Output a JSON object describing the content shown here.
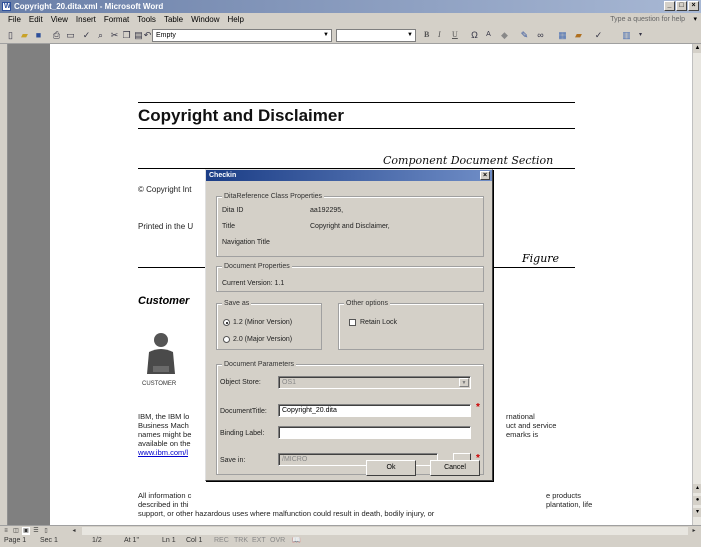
{
  "window": {
    "title": "Copyright_20.dita.xml - Microsoft Word",
    "controls": [
      "_",
      "□",
      "×"
    ]
  },
  "menubar": {
    "items": [
      "File",
      "Edit",
      "View",
      "Insert",
      "Format",
      "Tools",
      "Table",
      "Window",
      "Help"
    ],
    "help_placeholder": "Type a question for help"
  },
  "toolbar": {
    "style_value": "Empty",
    "formatting": [
      "B",
      "I",
      "U"
    ]
  },
  "document": {
    "title": "Copyright and Disclaimer",
    "component_section": "Component Document Section",
    "copyright_line": "© Copyright Int",
    "printed_line": "Printed in the U",
    "figure_label": "Figure",
    "customer_heading": "Customer",
    "customer_image_label": "CUSTOMER",
    "ibm_para_lines": [
      "IBM, the IBM lo",
      "Business Mach",
      "names might be",
      "available on the"
    ],
    "ibm_link": "www.ibm.com/l",
    "right_para_lines": [
      "rnational",
      "uct and service",
      "emarks is"
    ],
    "all_info_lines": [
      "All information c",
      "described in thi",
      "support, or other hazardous uses where malfunction could result in death, bodily injury, or"
    ],
    "all_info_right_lines": [
      "e products",
      "plantation, life"
    ]
  },
  "dialog": {
    "title": "Checkin",
    "class_props": {
      "legend": "DitaReference Class Properties",
      "dita_id_label": "Dita ID",
      "dita_id_value": "aa192295,",
      "title_label": "Title",
      "title_value": "Copyright and Disclaimer,",
      "nav_title_label": "Navigation Title"
    },
    "doc_props": {
      "legend": "Document Properties",
      "current_version": "Current Version: 1.1"
    },
    "save_as": {
      "legend": "Save as",
      "minor": "1.2 (Minor Version)",
      "major": "2.0 (Major Version)"
    },
    "other_options": {
      "legend": "Other options",
      "retain_lock": "Retain Lock"
    },
    "doc_params": {
      "legend": "Document Parameters",
      "object_store_label": "Object Store:",
      "object_store_value": "OS1",
      "document_title_label": "DocumentTitle:",
      "document_title_value": "Copyright_20.dita",
      "binding_label_label": "Binding Label:",
      "binding_label_value": "",
      "save_in_label": "Save in:",
      "save_in_value": "/MICRO"
    },
    "ok": "Ok",
    "cancel": "Cancel"
  },
  "statusbar": {
    "items": [
      "Page 1",
      "Sec 1",
      "1/2",
      "At 1\"",
      "Ln 1",
      "Col 1",
      "REC",
      "TRK",
      "EXT",
      "OVR"
    ]
  }
}
